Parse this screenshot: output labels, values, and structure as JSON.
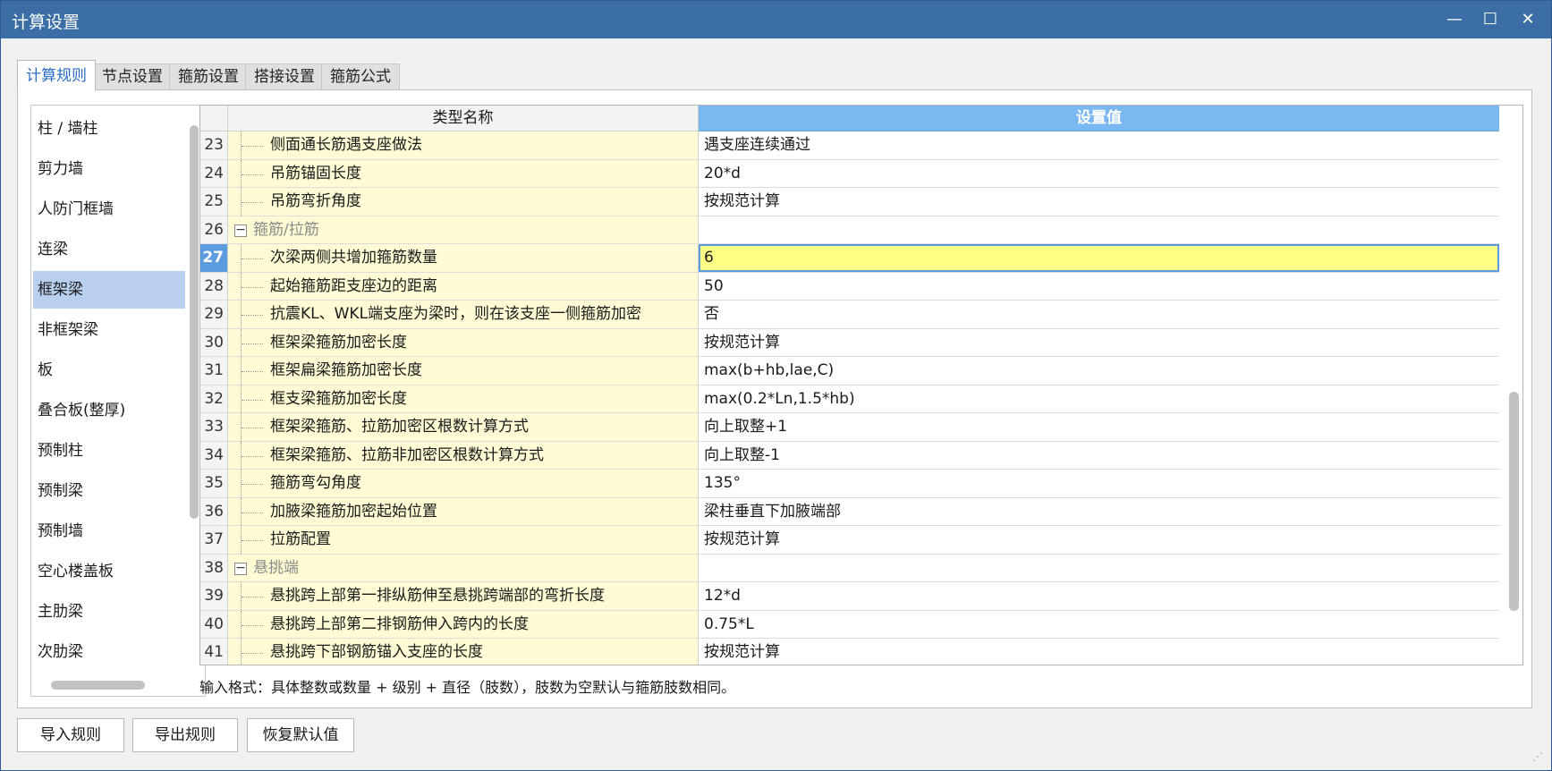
{
  "window": {
    "title": "计算设置",
    "min_glyph": "—",
    "max_glyph": "☐",
    "close_glyph": "✕"
  },
  "tabs": [
    {
      "label": "计算规则",
      "active": true
    },
    {
      "label": "节点设置",
      "active": false
    },
    {
      "label": "箍筋设置",
      "active": false
    },
    {
      "label": "搭接设置",
      "active": false
    },
    {
      "label": "箍筋公式",
      "active": false
    }
  ],
  "left_list": {
    "items": [
      "柱 / 墙柱",
      "剪力墙",
      "人防门框墙",
      "连梁",
      "框架梁",
      "非框架梁",
      "板",
      "叠合板(整厚)",
      "预制柱",
      "预制梁",
      "预制墙",
      "空心楼盖板",
      "主肋梁",
      "次肋梁"
    ],
    "selected": "框架梁"
  },
  "grid": {
    "col_name": "类型名称",
    "col_value": "设置值",
    "rows": [
      {
        "num": "23",
        "name": "侧面通长筋遇支座做法",
        "value": "遇支座连续通过"
      },
      {
        "num": "24",
        "name": "吊筋锚固长度",
        "value": "20*d"
      },
      {
        "num": "25",
        "name": "吊筋弯折角度",
        "value": "按规范计算"
      },
      {
        "num": "26",
        "name": "箍筋/拉筋",
        "value": "",
        "group": true,
        "expander": "−"
      },
      {
        "num": "27",
        "name": "次梁两侧共增加箍筋数量",
        "value": "6",
        "active": true
      },
      {
        "num": "28",
        "name": "起始箍筋距支座边的距离",
        "value": "50"
      },
      {
        "num": "29",
        "name": "抗震KL、WKL端支座为梁时，则在该支座一侧箍筋加密",
        "value": "否"
      },
      {
        "num": "30",
        "name": "框架梁箍筋加密长度",
        "value": "按规范计算"
      },
      {
        "num": "31",
        "name": "框架扁梁箍筋加密长度",
        "value": "max(b+hb,lae,C)"
      },
      {
        "num": "32",
        "name": "框支梁箍筋加密长度",
        "value": "max(0.2*Ln,1.5*hb)"
      },
      {
        "num": "33",
        "name": "框架梁箍筋、拉筋加密区根数计算方式",
        "value": "向上取整+1"
      },
      {
        "num": "34",
        "name": "框架梁箍筋、拉筋非加密区根数计算方式",
        "value": "向上取整-1"
      },
      {
        "num": "35",
        "name": "箍筋弯勾角度",
        "value": "135°"
      },
      {
        "num": "36",
        "name": "加腋梁箍筋加密起始位置",
        "value": "梁柱垂直下加腋端部"
      },
      {
        "num": "37",
        "name": "拉筋配置",
        "value": "按规范计算"
      },
      {
        "num": "38",
        "name": "悬挑端",
        "value": "",
        "group": true,
        "expander": "−"
      },
      {
        "num": "39",
        "name": "悬挑跨上部第一排纵筋伸至悬挑跨端部的弯折长度",
        "value": "12*d"
      },
      {
        "num": "40",
        "name": "悬挑跨上部第二排钢筋伸入跨内的长度",
        "value": "0.75*L"
      },
      {
        "num": "41",
        "name": "悬挑跨下部钢筋锚入支座的长度",
        "value": "按规范计算"
      }
    ]
  },
  "hint": "输入格式：具体整数或数量 + 级别 + 直径（肢数），肢数为空默认与箍筋肢数相同。",
  "buttons": {
    "import": "导入规则",
    "export": "导出规则",
    "restore": "恢复默认值"
  },
  "grip_glyph": "⋰"
}
